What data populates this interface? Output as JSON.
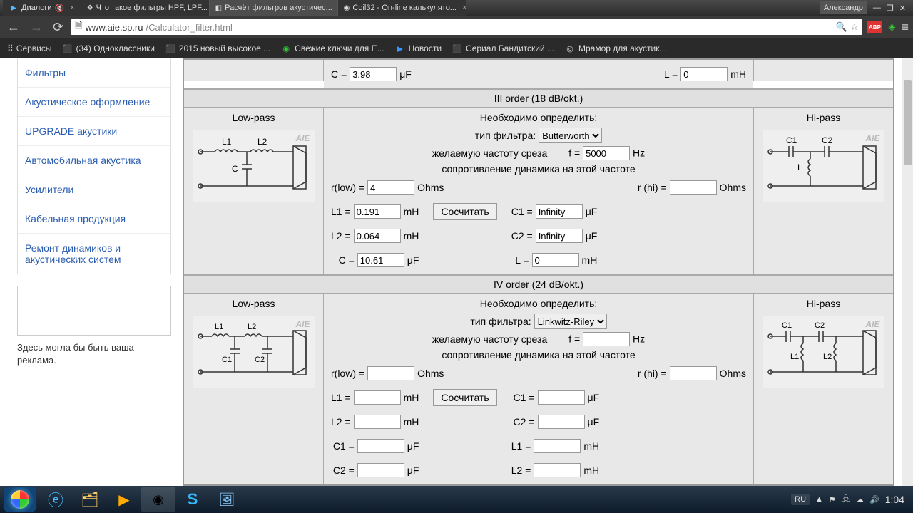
{
  "titlebar": {
    "tabs": [
      {
        "label": "Диалоги",
        "icon": "▶"
      },
      {
        "label": "Что такое фильтры HPF, LPF...",
        "icon": "❖"
      },
      {
        "label": "Расчёт фильтров акустичес...",
        "icon": "◧",
        "active": true
      },
      {
        "label": "Coil32 - On-line калькулято...",
        "icon": "◉"
      }
    ],
    "user": "Александр",
    "minimize": "—",
    "maximize": "❐",
    "close": "✕"
  },
  "urlbar": {
    "back": "←",
    "forward": "→",
    "reload": "⟳",
    "doc_icon": "🗎",
    "host": "www.aie.sp.ru",
    "path": "/Calculator_filter.html",
    "search_icon": "🔍",
    "star_icon": "☆",
    "abp": "ABP",
    "shield": "◈",
    "menu": "≡"
  },
  "bookmarks": {
    "apps": "Сервисы",
    "items": [
      {
        "icon": "⬛",
        "iconColor": "#f90",
        "label": "(34) Одноклассники"
      },
      {
        "icon": "⬛",
        "iconColor": "#d33",
        "label": "2015 новый высокое ..."
      },
      {
        "icon": "◉",
        "iconColor": "#3c3",
        "label": "Свежие ключи для E..."
      },
      {
        "icon": "▶",
        "iconColor": "#39f",
        "label": "Новости"
      },
      {
        "icon": "⬛",
        "iconColor": "#666",
        "label": "Сериал Бандитский ..."
      },
      {
        "icon": "◎",
        "iconColor": "#ccc",
        "label": "Мрамор для акустик..."
      }
    ]
  },
  "sidebar": {
    "items": [
      "Фильтры",
      "Акустическое оформление",
      "UPGRADE акустики",
      "Автомобильная акустика",
      "Усилители",
      "Кабельная продукция",
      "Ремонт динамиков и акустических систем"
    ],
    "ad_text": "Здесь могла бы быть ваша реклама."
  },
  "topresult": {
    "c_lbl": "C =",
    "c_val": "3.98",
    "c_unit": "μF",
    "l_lbl": "L =",
    "l_val": "0",
    "l_unit": "mH"
  },
  "order3": {
    "header": "III order (18 dB/okt.)",
    "lowpass": "Low-pass",
    "hipass": "Hi-pass",
    "define": "Необходимо определить:",
    "filter_type_lbl": "тип фильтра:",
    "filter_type_val": "Butterworth",
    "freq_lbl": "желаемую частоту среза",
    "f_lbl": "f =",
    "f_val": "5000",
    "f_unit": "Hz",
    "imp_lbl": "сопротивление динамика на этой частоте",
    "rlow_lbl": "r(low) =",
    "rlow_val": "4",
    "ohms": "Ohms",
    "rhi_lbl": "r (hi) =",
    "rhi_val": "",
    "calc": "Сосчитать",
    "l1_lbl": "L1 =",
    "l1_val": "0.191",
    "mh": "mH",
    "l2_lbl": "L2 =",
    "l2_val": "0.064",
    "c_lbl": "C =",
    "c_val": "10.61",
    "uf": "μF",
    "c1_lbl": "C1 =",
    "c1_val": "Infinity",
    "c2_lbl": "C2 =",
    "c2_val": "Infinity",
    "hl_lbl": "L =",
    "hl_val": "0"
  },
  "order4": {
    "header": "IV order (24 dB/okt.)",
    "lowpass": "Low-pass",
    "hipass": "Hi-pass",
    "define": "Необходимо определить:",
    "filter_type_lbl": "тип фильтра:",
    "filter_type_val": "Linkwitz-Riley",
    "freq_lbl": "желаемую частоту среза",
    "f_lbl": "f =",
    "f_val": "",
    "f_unit": "Hz",
    "imp_lbl": "сопротивление динамика на этой частоте",
    "rlow_lbl": "r(low) =",
    "rlow_val": "",
    "ohms": "Ohms",
    "rhi_lbl": "r (hi) =",
    "rhi_val": "",
    "calc": "Сосчитать",
    "l1_lbl": "L1 =",
    "l1_val": "",
    "l2_lbl": "L2 =",
    "l2_val": "",
    "c1l_lbl": "C1 =",
    "c1l_val": "",
    "c2l_lbl": "C2 =",
    "c2l_val": "",
    "c1_lbl": "C1 =",
    "c1_val": "",
    "c2_lbl": "C2 =",
    "c2_val": "",
    "hl1_lbl": "L1 =",
    "hl1_val": "",
    "hl2_lbl": "L2 =",
    "hl2_val": "",
    "mh": "mH",
    "uf": "μF"
  },
  "circuits": {
    "lp3": {
      "l1": "L1",
      "l2": "L2",
      "c": "C",
      "wm": "AIE"
    },
    "hp3": {
      "c1": "C1",
      "c2": "C2",
      "l": "L",
      "wm": "AIE"
    },
    "lp4": {
      "l1": "L1",
      "l2": "L2",
      "c1": "C1",
      "c2": "C2",
      "wm": "AIE"
    },
    "hp4": {
      "c1": "C1",
      "c2": "C2",
      "l1": "L1",
      "l2": "L2",
      "wm": "AIE"
    }
  },
  "taskbar": {
    "lang": "RU",
    "up": "▲",
    "clock": "1:04"
  }
}
